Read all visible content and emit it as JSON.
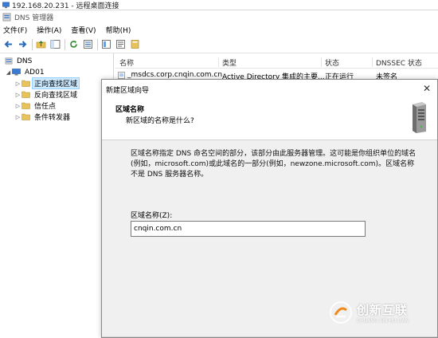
{
  "rdp": {
    "title": "192.168.20.231 - 远程桌面连接"
  },
  "app": {
    "title": "DNS 管理器"
  },
  "menu": {
    "items": [
      "文件(F)",
      "操作(A)",
      "查看(V)",
      "帮助(H)"
    ]
  },
  "tree": {
    "root": "DNS",
    "server": "AD01",
    "children": [
      "正向查找区域",
      "反向查找区域",
      "信任点",
      "条件转发器"
    ],
    "selected": "正向查找区域"
  },
  "list": {
    "columns": [
      "名称",
      "类型",
      "状态",
      "DNSSEC 状态"
    ],
    "rows": [
      {
        "name": "_msdcs.corp.cnqin.com.cn",
        "type": "Active Directory 集成的主要...",
        "status": "正在运行",
        "dnssec": "未签名"
      }
    ]
  },
  "wizard": {
    "title": "新建区域向导",
    "header_title": "区域名称",
    "header_subtitle": "新区域的名称是什么?",
    "description": "区域名称指定 DNS 命名空间的部分，该部分由此服务器管理。这可能是你组织单位的域名(例如，microsoft.com)或此域名的一部分(例如，newzone.microsoft.com)。区域名称不是 DNS 服务器名称。",
    "field_label": "区域名称(Z):",
    "field_value": "cnqin.com.cn",
    "close_glyph": "✕"
  },
  "watermark": {
    "cn": "创新互联",
    "en": "CHUANG XIN HU LIAN"
  },
  "colors": {
    "selection": "#cce8ff",
    "folder": "#e8c25a",
    "dialog_bg": "#f0f0f0",
    "watermark_orange": "#f08a1c"
  }
}
